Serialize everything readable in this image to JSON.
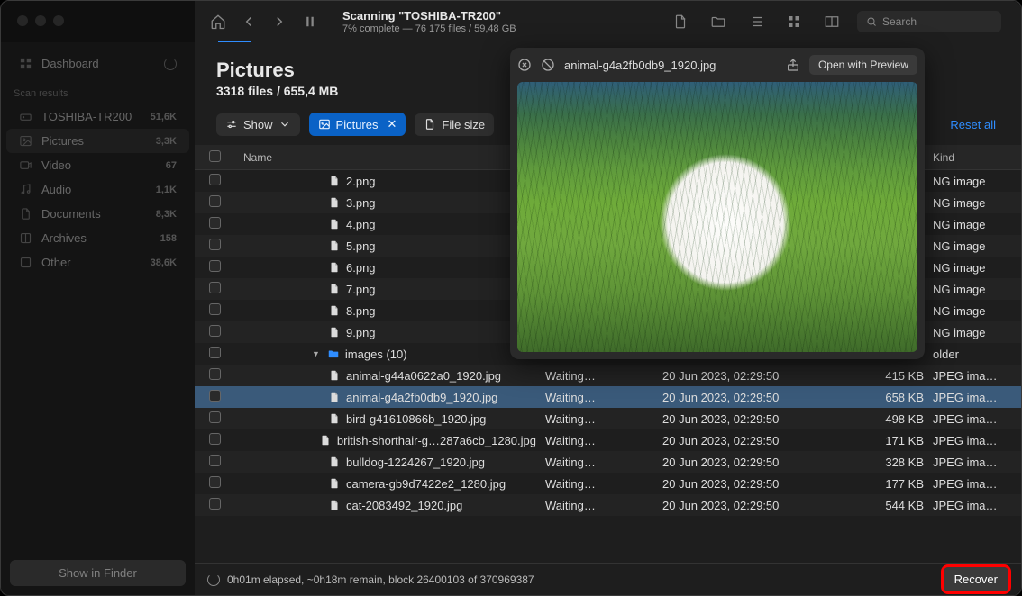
{
  "scan": {
    "title": "Scanning \"TOSHIBA-TR200\"",
    "subtitle": "7% complete — 76 175 files / 59,48 GB"
  },
  "search_placeholder": "Search",
  "sidebar": {
    "dashboard": "Dashboard",
    "section_title": "Scan results",
    "items": [
      {
        "icon": "drive",
        "label": "TOSHIBA-TR200",
        "count": "51,6K"
      },
      {
        "icon": "pictures",
        "label": "Pictures",
        "count": "3,3K"
      },
      {
        "icon": "video",
        "label": "Video",
        "count": "67"
      },
      {
        "icon": "audio",
        "label": "Audio",
        "count": "1,1K"
      },
      {
        "icon": "documents",
        "label": "Documents",
        "count": "8,3K"
      },
      {
        "icon": "archives",
        "label": "Archives",
        "count": "158"
      },
      {
        "icon": "other",
        "label": "Other",
        "count": "38,6K"
      }
    ],
    "show_in_finder": "Show in Finder"
  },
  "header": {
    "title": "Pictures",
    "subtitle": "3318 files / 655,4 MB"
  },
  "actionbar": {
    "show": "Show",
    "filter_pictures": "Pictures",
    "filter_filesize": "File size",
    "reset": "Reset all"
  },
  "columns": {
    "name": "Name",
    "kind": "Kind"
  },
  "rows": [
    {
      "indent": 1,
      "type": "file",
      "name": "2.png",
      "preview": "",
      "date": "",
      "size": "",
      "kind": "NG image"
    },
    {
      "indent": 1,
      "type": "file",
      "name": "3.png",
      "preview": "",
      "date": "",
      "size": "",
      "kind": "NG image"
    },
    {
      "indent": 1,
      "type": "file",
      "name": "4.png",
      "preview": "",
      "date": "",
      "size": "",
      "kind": "NG image"
    },
    {
      "indent": 1,
      "type": "file",
      "name": "5.png",
      "preview": "",
      "date": "",
      "size": "",
      "kind": "NG image"
    },
    {
      "indent": 1,
      "type": "file",
      "name": "6.png",
      "preview": "",
      "date": "",
      "size": "",
      "kind": "NG image"
    },
    {
      "indent": 1,
      "type": "file",
      "name": "7.png",
      "preview": "",
      "date": "",
      "size": "",
      "kind": "NG image"
    },
    {
      "indent": 1,
      "type": "file",
      "name": "8.png",
      "preview": "",
      "date": "",
      "size": "",
      "kind": "NG image"
    },
    {
      "indent": 1,
      "type": "file",
      "name": "9.png",
      "preview": "",
      "date": "",
      "size": "",
      "kind": "NG image"
    },
    {
      "indent": 0,
      "type": "folder-open",
      "name": "images (10)",
      "preview": "",
      "date": "",
      "size": "",
      "kind": "older"
    },
    {
      "indent": 1,
      "type": "file",
      "name": "animal-g44a0622a0_1920.jpg",
      "preview": "Waiting…",
      "date": "20 Jun 2023, 02:29:50",
      "size": "415 KB",
      "kind": "JPEG ima…"
    },
    {
      "indent": 1,
      "type": "file",
      "name": "animal-g4a2fb0db9_1920.jpg",
      "preview": "Waiting…",
      "date": "20 Jun 2023, 02:29:50",
      "size": "658 KB",
      "kind": "JPEG ima…",
      "selected": true
    },
    {
      "indent": 1,
      "type": "file",
      "name": "bird-g41610866b_1920.jpg",
      "preview": "Waiting…",
      "date": "20 Jun 2023, 02:29:50",
      "size": "498 KB",
      "kind": "JPEG ima…"
    },
    {
      "indent": 1,
      "type": "file",
      "name": "british-shorthair-g…287a6cb_1280.jpg",
      "preview": "Waiting…",
      "date": "20 Jun 2023, 02:29:50",
      "size": "171 KB",
      "kind": "JPEG ima…"
    },
    {
      "indent": 1,
      "type": "file",
      "name": "bulldog-1224267_1920.jpg",
      "preview": "Waiting…",
      "date": "20 Jun 2023, 02:29:50",
      "size": "328 KB",
      "kind": "JPEG ima…"
    },
    {
      "indent": 1,
      "type": "file",
      "name": "camera-gb9d7422e2_1280.jpg",
      "preview": "Waiting…",
      "date": "20 Jun 2023, 02:29:50",
      "size": "177 KB",
      "kind": "JPEG ima…"
    },
    {
      "indent": 1,
      "type": "file",
      "name": "cat-2083492_1920.jpg",
      "preview": "Waiting…",
      "date": "20 Jun 2023, 02:29:50",
      "size": "544 KB",
      "kind": "JPEG ima…"
    }
  ],
  "preview": {
    "filename": "animal-g4a2fb0db9_1920.jpg",
    "open_label": "Open with Preview"
  },
  "footer": {
    "status": "0h01m elapsed, ~0h18m remain, block 26400103 of 370969387",
    "recover": "Recover"
  }
}
